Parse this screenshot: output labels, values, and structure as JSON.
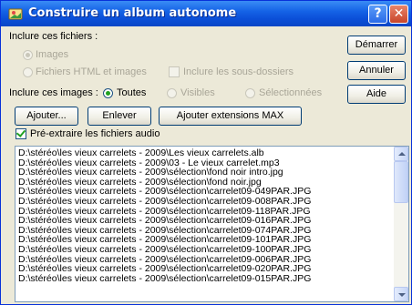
{
  "window": {
    "title": "Construire un album autonome",
    "help_glyph": "?",
    "close_glyph": "✕"
  },
  "include_files": {
    "label": "Inclure ces fichiers :",
    "images": "Images",
    "html_images": "Fichiers HTML et images",
    "subfolders": "Inclure les sous-dossiers"
  },
  "include_images": {
    "label": "Inclure ces images :",
    "all": "Toutes",
    "visible": "Visibles",
    "selected": "Sélectionnées"
  },
  "buttons": {
    "start": "Démarrer",
    "cancel": "Annuler",
    "help": "Aide",
    "add": "Ajouter...",
    "remove": "Enlever",
    "add_max": "Ajouter extensions MAX"
  },
  "preextract": {
    "label": "Pré-extraire les fichiers audio",
    "checked": true
  },
  "file_list": [
    "D:\\stéréo\\les vieux carrelets - 2009\\Les vieux carrelets.alb",
    "D:\\stéréo\\les vieux carrelets - 2009\\03 - Le vieux carrelet.mp3",
    "D:\\stéréo\\les vieux carrelets - 2009\\sélection\\fond noir intro.jpg",
    "D:\\stéréo\\les vieux carrelets - 2009\\sélection\\fond noir.jpg",
    "D:\\stéréo\\les vieux carrelets - 2009\\sélection\\carrelet09-049PAR.JPG",
    "D:\\stéréo\\les vieux carrelets - 2009\\sélection\\carrelet09-008PAR.JPG",
    "D:\\stéréo\\les vieux carrelets - 2009\\sélection\\carrelet09-118PAR.JPG",
    "D:\\stéréo\\les vieux carrelets - 2009\\sélection\\carrelet09-016PAR.JPG",
    "D:\\stéréo\\les vieux carrelets - 2009\\sélection\\carrelet09-074PAR.JPG",
    "D:\\stéréo\\les vieux carrelets - 2009\\sélection\\carrelet09-101PAR.JPG",
    "D:\\stéréo\\les vieux carrelets - 2009\\sélection\\carrelet09-100PAR.JPG",
    "D:\\stéréo\\les vieux carrelets - 2009\\sélection\\carrelet09-006PAR.JPG",
    "D:\\stéréo\\les vieux carrelets - 2009\\sélection\\carrelet09-020PAR.JPG",
    "D:\\stéréo\\les vieux carrelets - 2009\\sélection\\carrelet09-015PAR.JPG"
  ],
  "colors": {
    "titlebar": "#0b4fd8",
    "dialog_bg": "#ece9d8",
    "check_green": "#21a121"
  },
  "icons": {
    "title": "album-icon",
    "scroll_up": "scroll-up-arrow-icon",
    "scroll_down": "scroll-down-arrow-icon"
  }
}
